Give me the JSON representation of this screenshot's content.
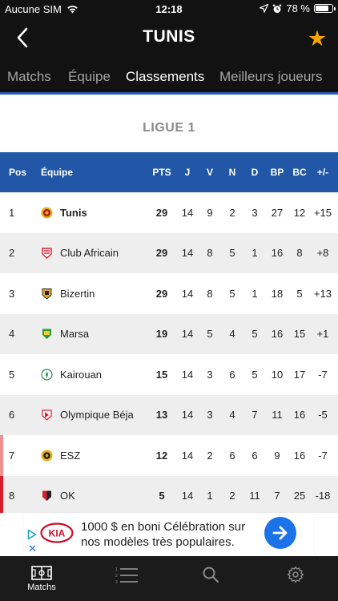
{
  "status_bar": {
    "carrier": "Aucune SIM",
    "time": "12:18",
    "battery_percent": "78 %",
    "battery_level": 0.78
  },
  "header": {
    "title": "TUNIS",
    "back_icon": "chevron-left-icon",
    "favorite_icon": "star-icon",
    "favorite_color": "#f5a800"
  },
  "tabs": [
    {
      "label": "Matchs",
      "active": false
    },
    {
      "label": "Équipe",
      "active": false
    },
    {
      "label": "Classements",
      "active": true
    },
    {
      "label": "Meilleurs joueurs",
      "active": false
    }
  ],
  "league": {
    "name": "LIGUE 1"
  },
  "standings": {
    "columns": {
      "pos": "Pos",
      "team": "Équipe",
      "pts": "PTS",
      "j": "J",
      "v": "V",
      "n": "N",
      "d": "D",
      "bp": "BP",
      "bc": "BC",
      "diff": "+/-"
    },
    "header_color": "#2157a6",
    "rows": [
      {
        "pos": "1",
        "team": "Tunis",
        "highlight": true,
        "pts": "29",
        "j": "14",
        "v": "9",
        "n": "2",
        "d": "3",
        "bp": "27",
        "bc": "12",
        "diff": "+15"
      },
      {
        "pos": "2",
        "team": "Club Africain",
        "pts": "29",
        "j": "14",
        "v": "8",
        "n": "5",
        "d": "1",
        "bp": "16",
        "bc": "8",
        "diff": "+8"
      },
      {
        "pos": "3",
        "team": "Bizertin",
        "pts": "29",
        "j": "14",
        "v": "8",
        "n": "5",
        "d": "1",
        "bp": "18",
        "bc": "5",
        "diff": "+13"
      },
      {
        "pos": "4",
        "team": "Marsa",
        "pts": "19",
        "j": "14",
        "v": "5",
        "n": "4",
        "d": "5",
        "bp": "16",
        "bc": "15",
        "diff": "+1"
      },
      {
        "pos": "5",
        "team": "Kairouan",
        "pts": "15",
        "j": "14",
        "v": "3",
        "n": "6",
        "d": "5",
        "bp": "10",
        "bc": "17",
        "diff": "-7"
      },
      {
        "pos": "6",
        "team": "Olympique Béja",
        "pts": "13",
        "j": "14",
        "v": "3",
        "n": "4",
        "d": "7",
        "bp": "11",
        "bc": "16",
        "diff": "-5"
      },
      {
        "pos": "7",
        "team": "ESZ",
        "pts": "12",
        "j": "14",
        "v": "2",
        "n": "6",
        "d": "6",
        "bp": "9",
        "bc": "16",
        "diff": "-7",
        "zone_color": "#ef8f92"
      },
      {
        "pos": "8",
        "team": "OK",
        "pts": "5",
        "j": "14",
        "v": "1",
        "n": "2",
        "d": "11",
        "bp": "7",
        "bc": "25",
        "diff": "-18",
        "zone_color": "#d81e2c"
      }
    ]
  },
  "ad": {
    "brand": "KIA",
    "text": "1000 $ en boni Célébration sur nos modèles très populaires.",
    "close_label": "✕",
    "cta_icon": "arrow-right-icon"
  },
  "bottom_nav": [
    {
      "label": "Matchs",
      "icon": "pitch-icon"
    },
    {
      "label": "",
      "icon": "list-icon"
    },
    {
      "label": "",
      "icon": "search-icon"
    },
    {
      "label": "",
      "icon": "gear-icon"
    }
  ]
}
